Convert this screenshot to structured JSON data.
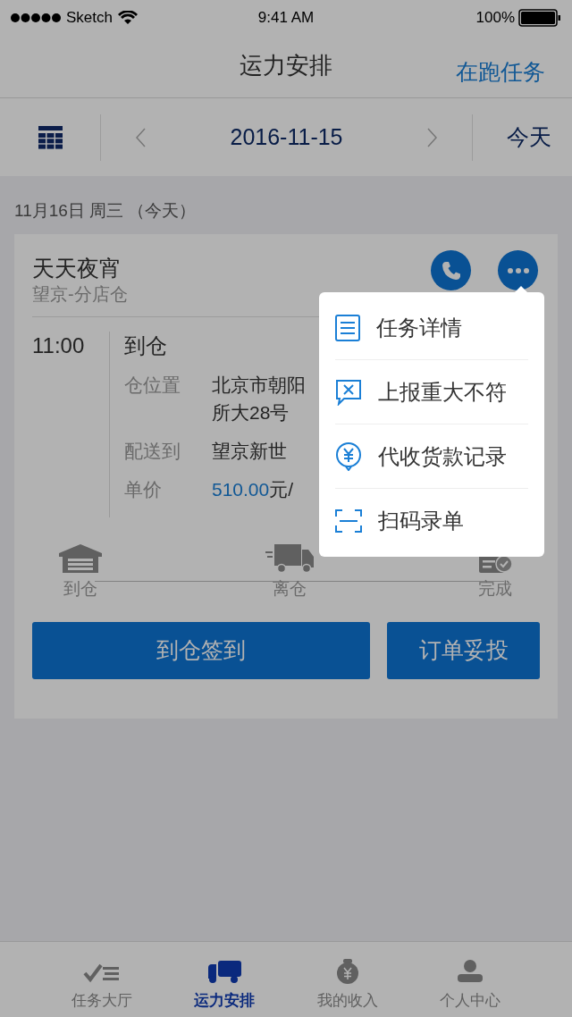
{
  "status_bar": {
    "carrier": "Sketch",
    "time": "9:41 AM",
    "battery": "100%"
  },
  "nav_bar": {
    "title": "运力安排",
    "action": "在跑任务"
  },
  "date_bar": {
    "date": "2016-11-15",
    "today_button": "今天"
  },
  "section_header": "11月16日 周三 （今天）",
  "task_card": {
    "name": "天天夜宵",
    "warehouse": "望京-分店仓",
    "time": "11:00",
    "stage": "到仓",
    "details": [
      {
        "kind": "text",
        "label": "仓位置",
        "lines": [
          "北京市朝阳",
          "所大28号"
        ]
      },
      {
        "kind": "text",
        "label": "配送到",
        "lines": [
          "望京新世"
        ]
      },
      {
        "kind": "price",
        "label": "单价",
        "value": "510.00",
        "unit": "元/"
      }
    ],
    "steps": [
      {
        "kind": "warehouse",
        "label": "到仓"
      },
      {
        "kind": "truck",
        "label": "离仓"
      },
      {
        "kind": "done",
        "label": "完成"
      }
    ],
    "buttons": [
      "到仓签到",
      "订单妥投"
    ]
  },
  "popup_menu": [
    {
      "kind": "details",
      "label": "任务详情"
    },
    {
      "kind": "report",
      "label": "上报重大不符"
    },
    {
      "kind": "payment",
      "label": "代收货款记录"
    },
    {
      "kind": "scan",
      "label": "扫码录单"
    }
  ],
  "tab_bar": [
    {
      "kind": "tasks",
      "label": "任务大厅",
      "selected": false
    },
    {
      "kind": "truck",
      "label": "运力安排",
      "selected": true
    },
    {
      "kind": "income",
      "label": "我的收入",
      "selected": false
    },
    {
      "kind": "person",
      "label": "个人中心",
      "selected": false
    }
  ]
}
